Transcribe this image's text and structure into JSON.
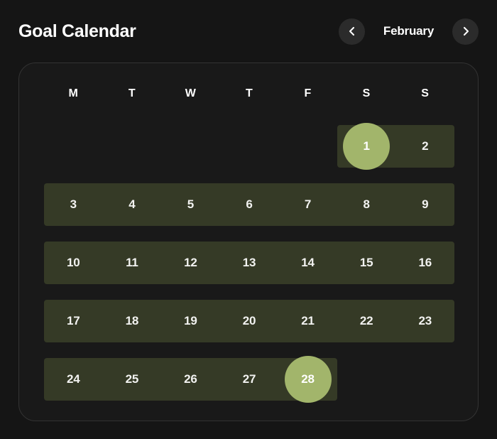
{
  "header": {
    "title": "Goal Calendar",
    "month_label": "February",
    "prev_icon": "chevron-left-icon",
    "next_icon": "chevron-right-icon"
  },
  "calendar": {
    "weekday_headers": [
      "M",
      "T",
      "W",
      "T",
      "F",
      "S",
      "S"
    ],
    "weeks": [
      {
        "days": [
          "",
          "",
          "",
          "",
          "",
          "1",
          "2"
        ],
        "band_start_col": 6,
        "band_end_col": 7
      },
      {
        "days": [
          "3",
          "4",
          "5",
          "6",
          "7",
          "8",
          "9"
        ],
        "band_start_col": 1,
        "band_end_col": 7
      },
      {
        "days": [
          "10",
          "11",
          "12",
          "13",
          "14",
          "15",
          "16"
        ],
        "band_start_col": 1,
        "band_end_col": 7
      },
      {
        "days": [
          "17",
          "18",
          "19",
          "20",
          "21",
          "22",
          "23"
        ],
        "band_start_col": 1,
        "band_end_col": 7
      },
      {
        "days": [
          "24",
          "25",
          "26",
          "27",
          "28",
          "",
          ""
        ],
        "band_start_col": 1,
        "band_end_col": 5
      }
    ],
    "highlighted_days": [
      "1",
      "28"
    ]
  },
  "colors": {
    "page_background": "#151515",
    "card_background": "#191919",
    "card_border": "#333333",
    "streak_band": "#353a26",
    "highlight_circle": "#a2b56b",
    "nav_button": "#2b2b2b",
    "text_primary": "#ffffff",
    "day_text": "#f2f2f0"
  }
}
